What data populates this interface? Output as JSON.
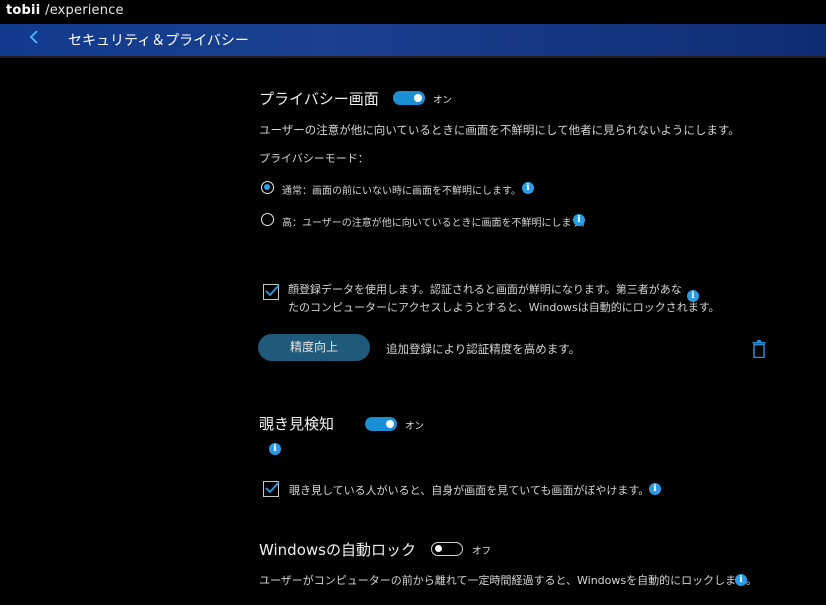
{
  "app": {
    "brand": "tobii",
    "brand_suffix": "/experience"
  },
  "header": {
    "back_icon": "chevron-left-icon",
    "title": "セキュリティ＆プライバシー"
  },
  "privacy_screen": {
    "title": "プライバシー画面",
    "toggle_label": "オン",
    "description": "ユーザーの注意が他に向いているときに画面を不鮮明にして他者に見られないようにします。",
    "mode_heading": "プライバシーモード：",
    "mode_normal": "通常：画面の前にいない時に画面を不鮮明にします。",
    "mode_high": "高：ユーザーの注意が他に向いているときに画面を不鮮明にします。",
    "face_line1": "顔登録データを使用します。認証されると画面が鮮明になります。第三者があな",
    "face_line2": "たのコンピューターにアクセスしようとすると、Windowsは自動的にロックされます。",
    "improve_button": "精度向上",
    "improve_desc": "追加登録により認証精度を高めます。"
  },
  "snoop_detect": {
    "title": "覗き見検知",
    "toggle_label": "オン",
    "option": "覗き見している人がいると、自身が画面を見ていても画面がぼやけます。"
  },
  "auto_lock": {
    "title": "Windowsの自動ロック",
    "toggle_label": "オフ",
    "description": "ユーザーがコンピューターの前から離れて一定時間経過すると、Windowsを自動的にロックします。"
  },
  "colors": {
    "accent": "#1a8fd6",
    "navbar": "#123a8c",
    "button": "#1f5a7a"
  }
}
